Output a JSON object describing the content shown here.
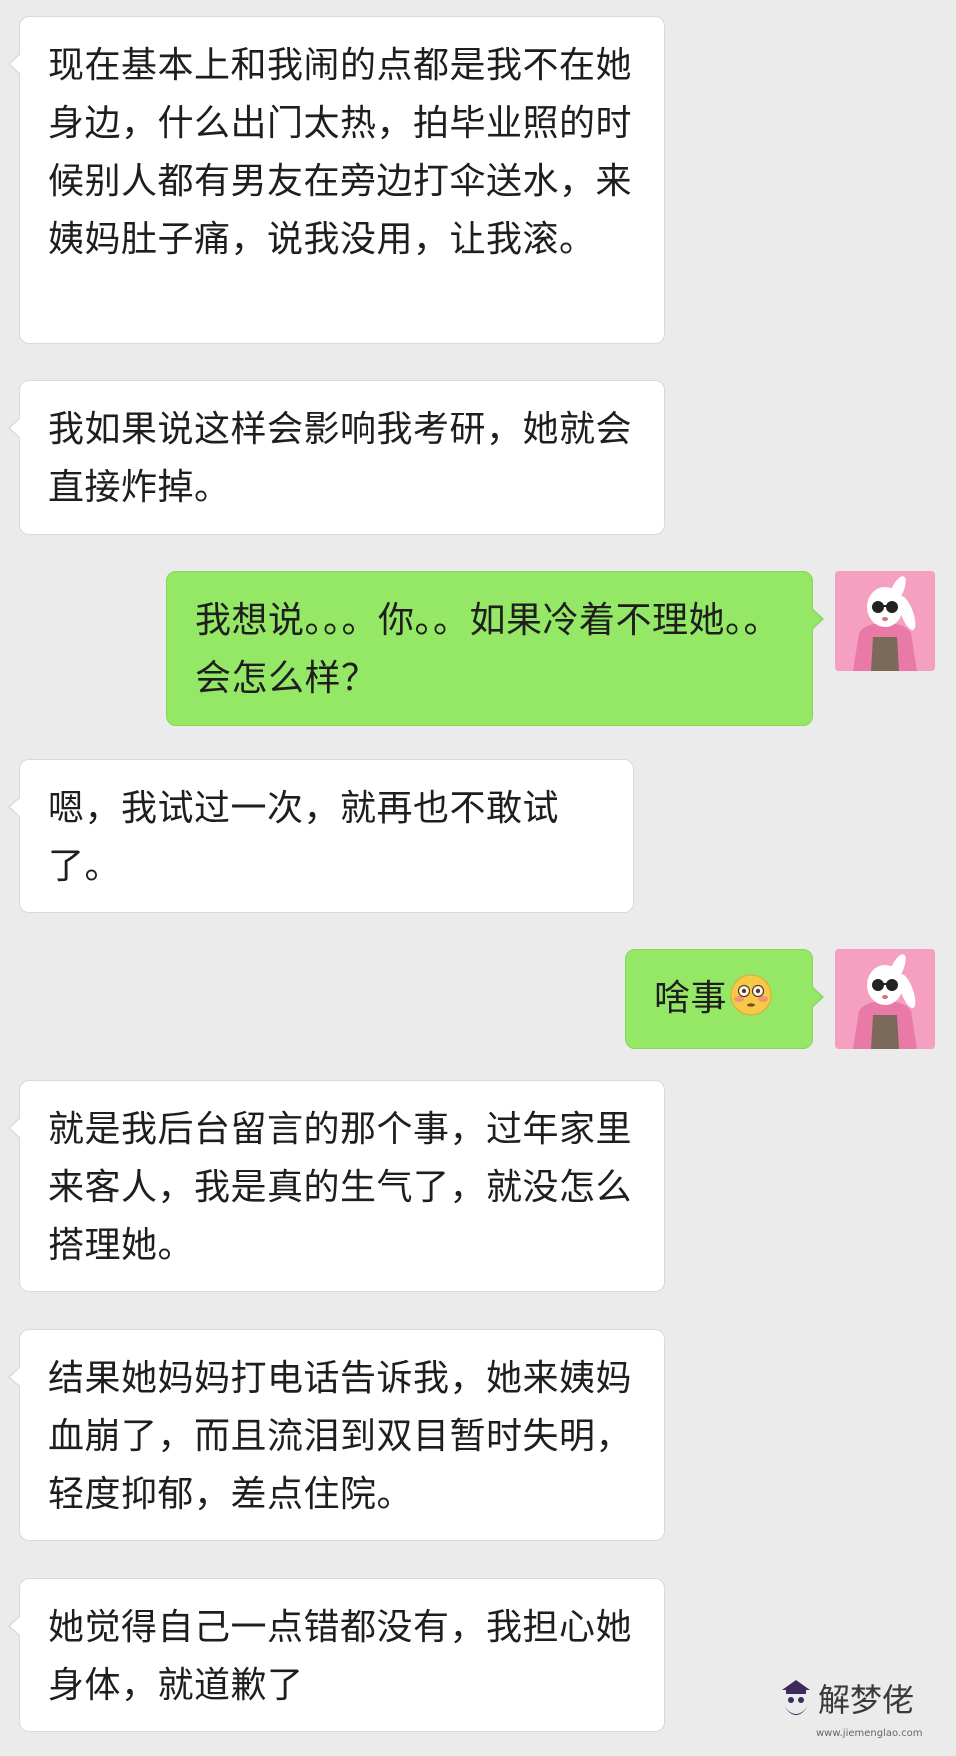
{
  "chat": {
    "messages": [
      {
        "side": "left",
        "text": "现在基本上和我闹的点都是我不在她身边，什么出门太热，拍毕业照的时候别人都有男友在旁边打伞送水，来姨妈肚子痛，说我没用，让我滚。"
      },
      {
        "side": "left",
        "text": "我如果说这样会影响我考研，她就会直接炸掉。"
      },
      {
        "side": "right",
        "text": "我想说。。。你。。如果冷着不理她。。会怎么样？"
      },
      {
        "side": "left",
        "text": "嗯，我试过一次，就再也不敢试了。"
      },
      {
        "side": "right",
        "text": "啥事",
        "emoji": "flushed-face"
      },
      {
        "side": "left",
        "text": "就是我后台留言的那个事，过年家里来客人，我是真的生气了，就没怎么搭理她。"
      },
      {
        "side": "left",
        "text": "结果她妈妈打电话告诉我，她来姨妈血崩了，而且流泪到双目暂时失明，轻度抑郁，差点住院。"
      },
      {
        "side": "left",
        "text": "她觉得自己一点错都没有，我担心她身体，就道歉了"
      }
    ]
  },
  "watermark": {
    "text": "解梦佬",
    "url": "www.jiemenglao.com"
  },
  "colors": {
    "background": "#ebebeb",
    "incoming_bubble": "#ffffff",
    "outgoing_bubble": "#95e766",
    "text": "#1e1e1e"
  }
}
